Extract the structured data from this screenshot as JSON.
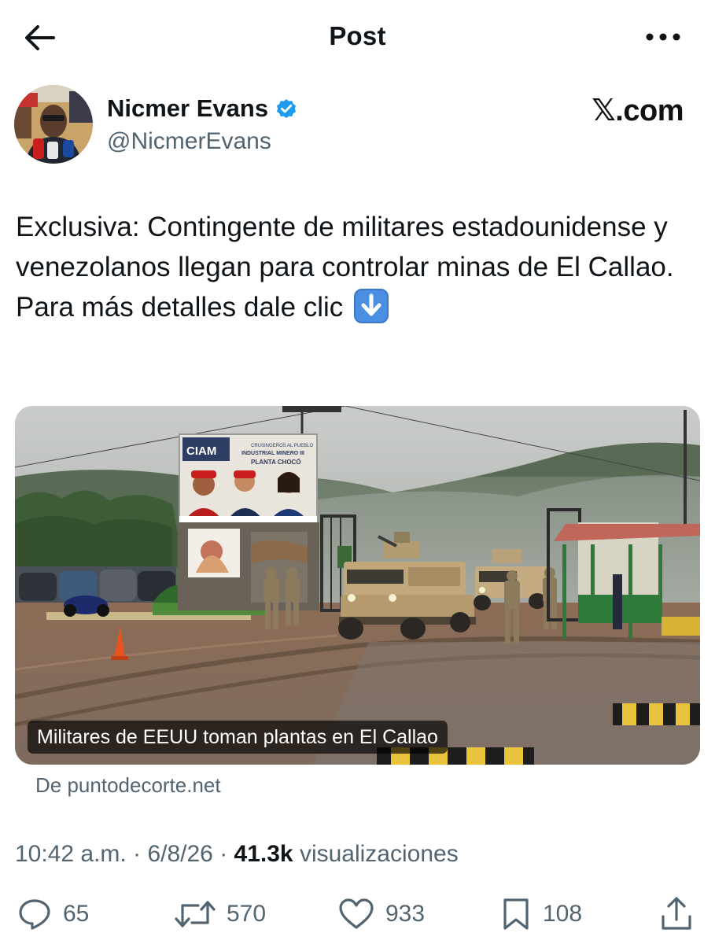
{
  "header": {
    "title": "Post",
    "back_icon": "arrow-left-icon",
    "more_icon": "more-horizontal-icon"
  },
  "author": {
    "name": "Nicmer Evans",
    "handle": "@NicmerEvans",
    "verified": true,
    "verified_color": "#1d9bf0"
  },
  "watermark": "𝕏.com",
  "post": {
    "text": "Exclusiva: Contingente de militares estadounidense y venezolanos llegan para controlar minas de El Callao. Para más detalles dale clic",
    "emoji": "down-arrow-emoji"
  },
  "media": {
    "caption": "Militares de EEUU toman plantas en El Callao",
    "billboard_text": [
      "CIAM",
      "CRUSINGEROS AL PUEBLO",
      "INDUSTRIAL MINERO III",
      "PLANTA CHOCÓ"
    ],
    "source": "De puntodecorte.net"
  },
  "meta": {
    "time": "10:42 a.m.",
    "sep1": " · ",
    "date": "6/8/26",
    "sep2": " · ",
    "views_count": "41.3k",
    "views_label": " visualizaciones"
  },
  "actions": {
    "reply": {
      "icon": "reply-icon",
      "count": "65"
    },
    "retweet": {
      "icon": "retweet-icon",
      "count": "570"
    },
    "like": {
      "icon": "heart-icon",
      "count": "933"
    },
    "bookmark": {
      "icon": "bookmark-icon",
      "count": "108"
    },
    "share": {
      "icon": "share-icon"
    }
  },
  "colors": {
    "text": "#0f1419",
    "secondary": "#536471",
    "accent": "#1d9bf0"
  }
}
